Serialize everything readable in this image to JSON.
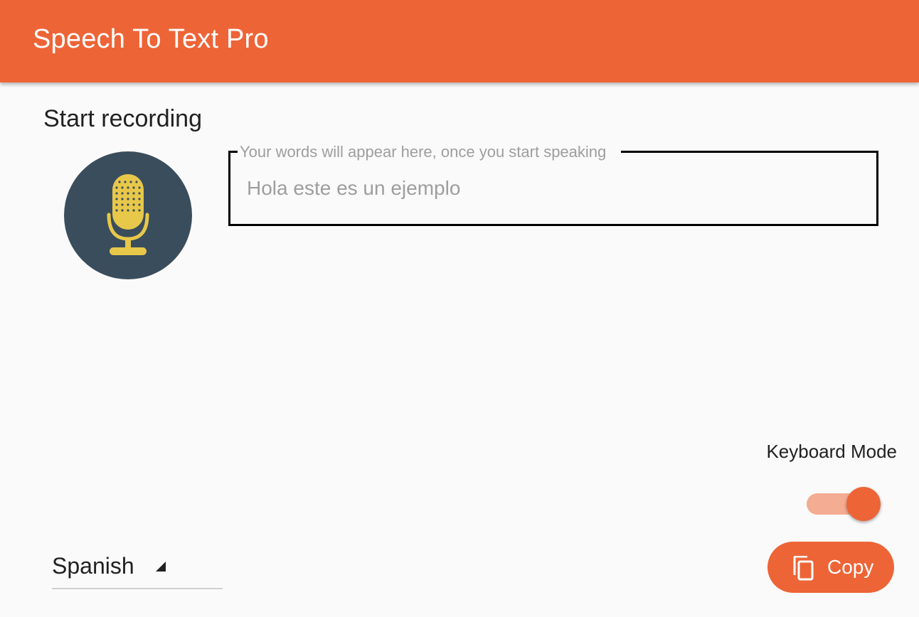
{
  "app_bar": {
    "title": "Speech To Text Pro",
    "color": "#ed6437"
  },
  "recording": {
    "heading": "Start recording",
    "mic_icon": "microphone-icon",
    "mic_bg_color": "#3a4d5c",
    "mic_color": "#e8c84a"
  },
  "transcript": {
    "label": "Your words will appear here, once you start speaking",
    "value": "Hola este es un ejemplo"
  },
  "keyboard_mode": {
    "label": "Keyboard Mode",
    "enabled": true
  },
  "language": {
    "selected": "Spanish",
    "icon": "dropdown-arrow-icon"
  },
  "copy": {
    "label": "Copy",
    "icon": "copy-icon"
  }
}
